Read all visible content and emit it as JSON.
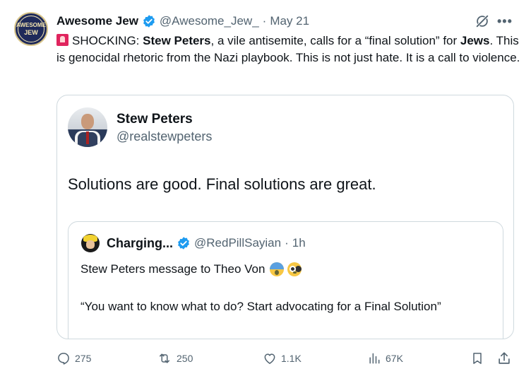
{
  "post": {
    "author": {
      "display_name": "Awesome Jew",
      "handle": "@Awesome_Jew_",
      "separator": "·",
      "date": "May 21",
      "avatar_text_top": "AWESOME",
      "avatar_text_bottom": "JEW",
      "icon": "awesome-jew-logo"
    },
    "text": {
      "prefix": "SHOCKING: ",
      "bold_1": "Stew Peters",
      "middle": ", a vile antisemite, calls for a “final solution” for ",
      "bold_2": "Jews",
      "suffix": ". This is genocidal rhetoric from the Nazi playbook. This is not just hate. It is a call to violence."
    },
    "quote": {
      "display_name": "Stew Peters",
      "handle": "@realstewpeters",
      "text": "Solutions are good. Final solutions are great.",
      "nested": {
        "display_name": "Charging...",
        "handle": "@RedPillSayian",
        "separator": "·",
        "time": "1h",
        "text_1": "Stew Peters message to Theo Von",
        "text_2": "“You want to know what to do? Start advocating for a Final Solution”"
      }
    },
    "actions": {
      "replies": "275",
      "reposts": "250",
      "likes": "1.1K",
      "views": "67K"
    },
    "colors": {
      "text": "#0f1419",
      "secondary": "#536471",
      "verified": "#1d9bf0",
      "border": "#cfd9de"
    }
  }
}
